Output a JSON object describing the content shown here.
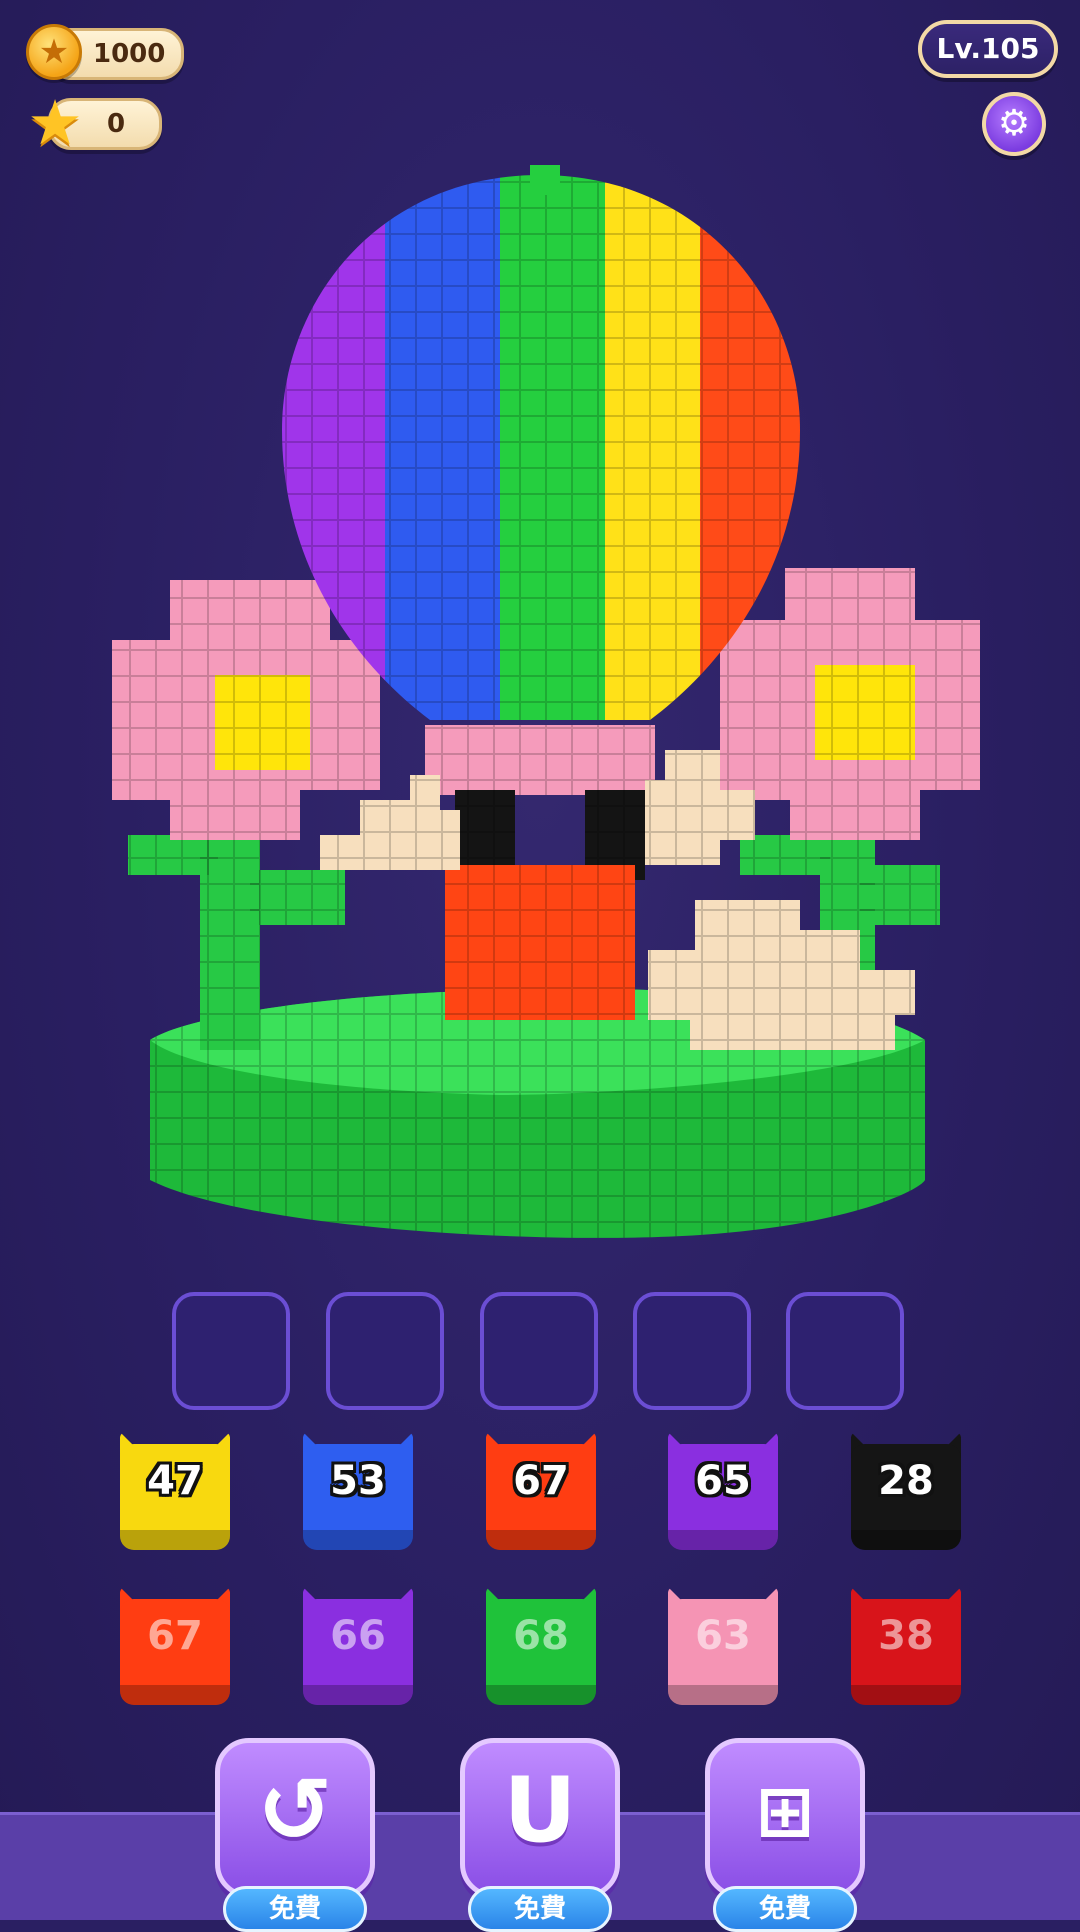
{
  "hud": {
    "coins": "1000",
    "stars": "0",
    "level": "Lv.105",
    "icons": {
      "coin": "coin-icon",
      "star": "star-icon",
      "settings": "gear-icon"
    }
  },
  "slots": {
    "count": 5
  },
  "blocks": [
    {
      "number": "47",
      "color": "#f8d90f",
      "style": "light"
    },
    {
      "number": "53",
      "color": "#2e5ef0",
      "style": "light"
    },
    {
      "number": "67",
      "color": "#ff3d12",
      "style": "light"
    },
    {
      "number": "65",
      "color": "#8a2fe0",
      "style": "light"
    },
    {
      "number": "28",
      "color": "#151515",
      "style": "light"
    },
    {
      "number": "67",
      "color": "#ff3d12",
      "style": "pale"
    },
    {
      "number": "66",
      "color": "#8a2fe0",
      "style": "pale"
    },
    {
      "number": "68",
      "color": "#1fc23a",
      "style": "pale"
    },
    {
      "number": "63",
      "color": "#f594b4",
      "style": "pale"
    },
    {
      "number": "38",
      "color": "#d8141a",
      "style": "pale"
    }
  ],
  "boosters": [
    {
      "name": "undo",
      "icon": "undo-icon",
      "label": "免費"
    },
    {
      "name": "magnet",
      "icon": "magnet-icon",
      "label": "免費"
    },
    {
      "name": "add-slot",
      "icon": "add-slot-icon",
      "label": "免費"
    }
  ]
}
